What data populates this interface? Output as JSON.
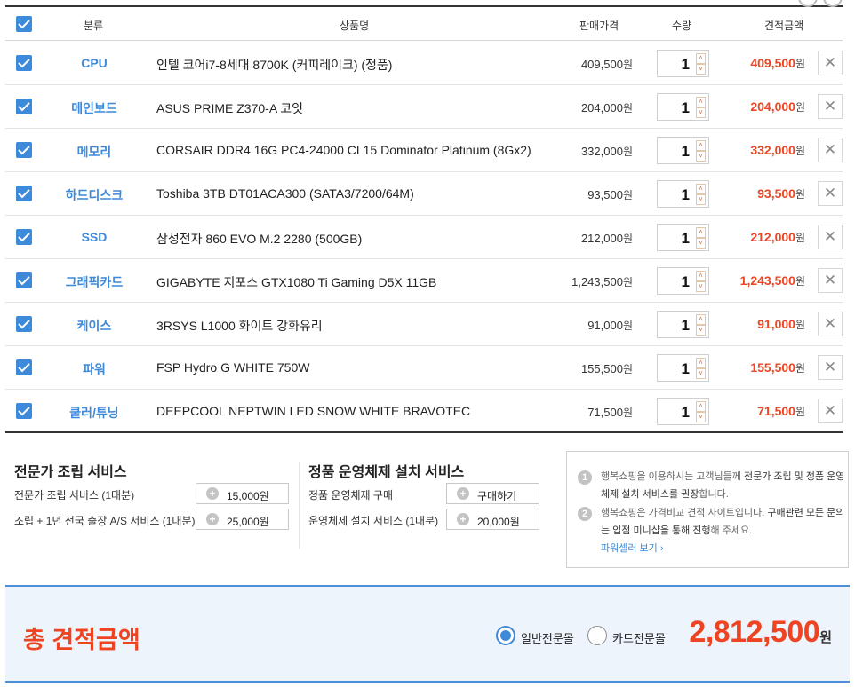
{
  "header": {
    "category": "분류",
    "product": "상품명",
    "price": "판매가격",
    "qty": "수량",
    "total": "견적금액"
  },
  "rows": [
    {
      "category": "CPU",
      "name": "인텔 코어i7-8세대 8700K (커피레이크) (정품)",
      "price": "409,500",
      "qty": "1",
      "total": "409,500"
    },
    {
      "category": "메인보드",
      "name": "ASUS PRIME Z370-A 코잇",
      "price": "204,000",
      "qty": "1",
      "total": "204,000"
    },
    {
      "category": "메모리",
      "name": "CORSAIR DDR4 16G PC4-24000 CL15 Dominator Platinum (8Gx2)",
      "price": "332,000",
      "qty": "1",
      "total": "332,000"
    },
    {
      "category": "하드디스크",
      "name": "Toshiba 3TB DT01ACA300 (SATA3/7200/64M)",
      "price": "93,500",
      "qty": "1",
      "total": "93,500"
    },
    {
      "category": "SSD",
      "name": "삼성전자 860 EVO M.2 2280 (500GB)",
      "price": "212,000",
      "qty": "1",
      "total": "212,000"
    },
    {
      "category": "그래픽카드",
      "name": "GIGABYTE 지포스 GTX1080 Ti Gaming D5X 11GB",
      "price": "1,243,500",
      "qty": "1",
      "total": "1,243,500"
    },
    {
      "category": "케이스",
      "name": "3RSYS L1000 화이트 강화유리",
      "price": "91,000",
      "qty": "1",
      "total": "91,000"
    },
    {
      "category": "파워",
      "name": "FSP Hydro G WHITE 750W",
      "price": "155,500",
      "qty": "1",
      "total": "155,500"
    },
    {
      "category": "쿨러/튜닝",
      "name": "DEEPCOOL NEPTWIN LED SNOW WHITE BRAVOTEC",
      "price": "71,500",
      "qty": "1",
      "total": "71,500"
    }
  ],
  "won": "원",
  "assembly": {
    "title": "전문가 조립 서비스",
    "items": [
      {
        "label": "전문가 조립 서비스 (1대분)",
        "button": "15,000원"
      },
      {
        "label": "조립 + 1년 전국 출장 A/S 서비스 (1대분)",
        "button": "25,000원"
      }
    ]
  },
  "os": {
    "title": "정품 운영체제 설치 서비스",
    "items": [
      {
        "label": "정품 운영체제 구매",
        "button": "구매하기"
      },
      {
        "label": "운영체제 설치 서비스 (1대분)",
        "button": "20,000원"
      }
    ]
  },
  "notice": {
    "n1": "1",
    "n2": "2",
    "line1a": "행복쇼핑을 이용하시는 고객님들께 ",
    "line1b": "전문가 조립 및 정품 운영체제 설치 서비스를 권장",
    "line1c": "합니다.",
    "line2a": "행복쇼핑은 가격비교 견적 사이트입니다. ",
    "line2b": "구매관련 모든 문의는 입점 미니샵을 통해 진행",
    "line2c": "해 주세요.",
    "link": "파워셀러 보기 ›"
  },
  "summary": {
    "label": "총 견적금액",
    "option1": "일반전문몰",
    "option2": "카드전문몰",
    "amount": "2,812,500",
    "unit": "원"
  },
  "colors": {
    "accent": "#3d89da",
    "price_red": "#ee4422"
  }
}
